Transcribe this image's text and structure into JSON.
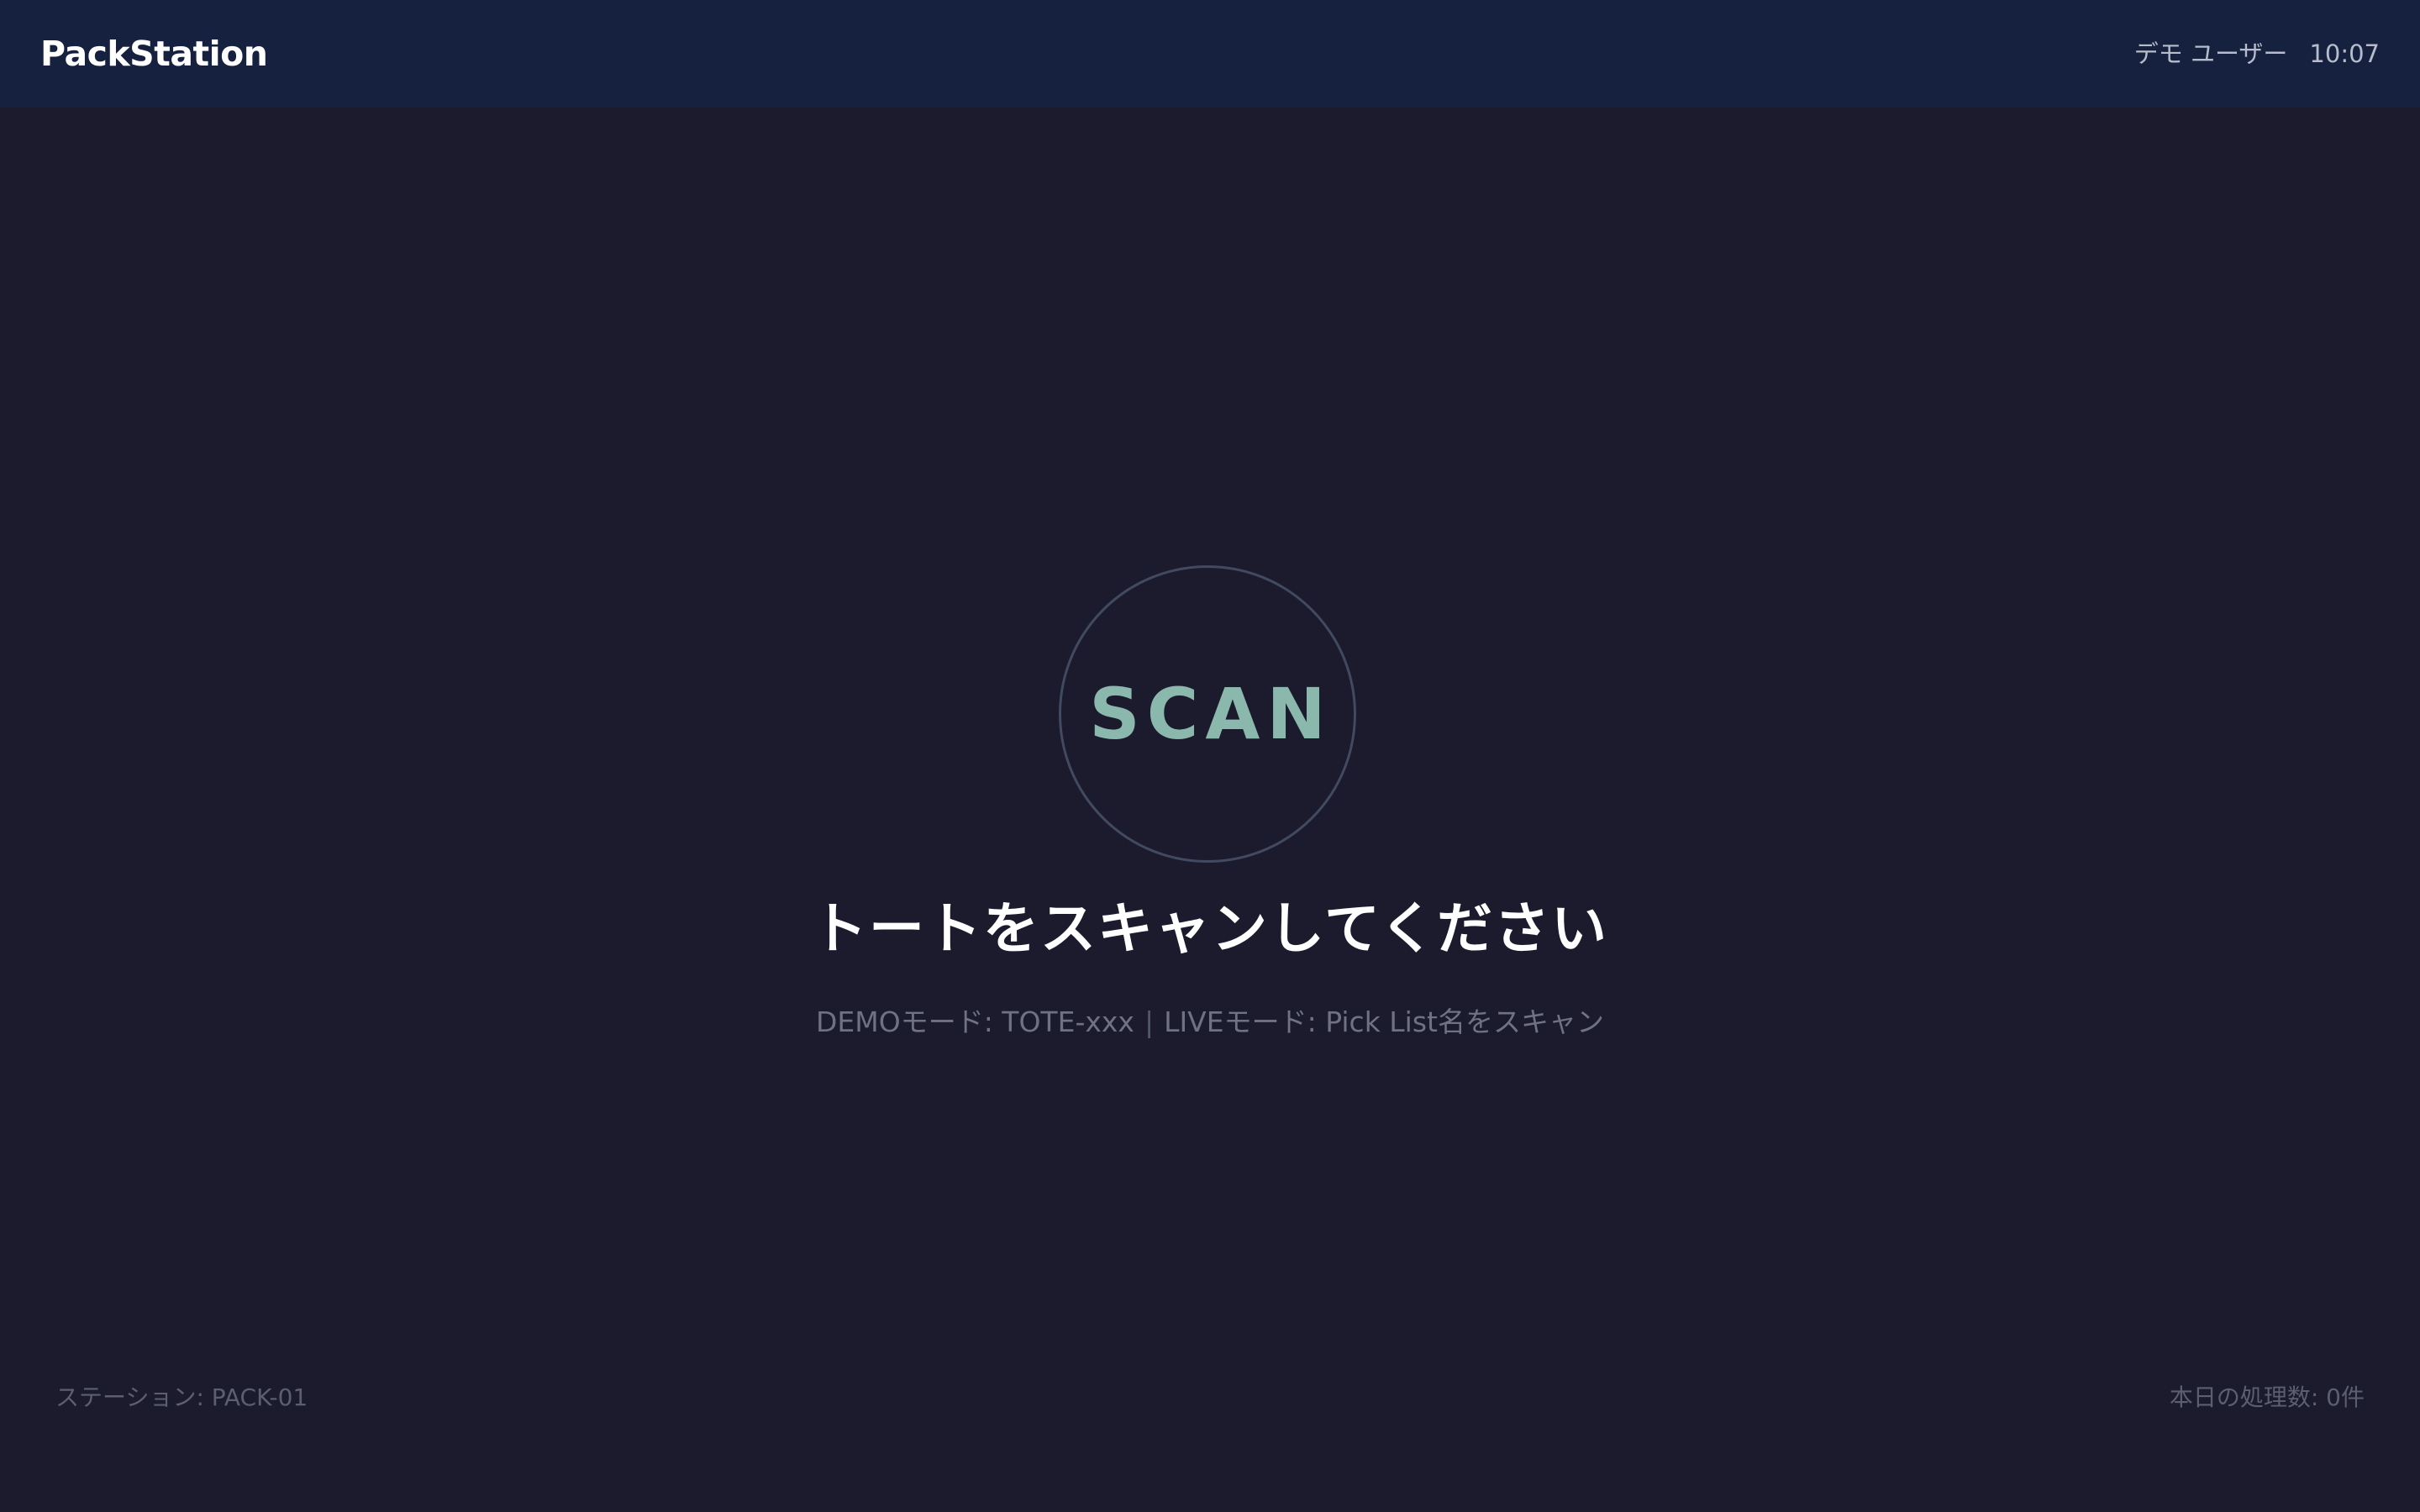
{
  "header": {
    "app_name": "PackStation",
    "user_name": "デモ ユーザー",
    "time": "10:07"
  },
  "scan": {
    "label": "SCAN",
    "instruction": "トートをスキャンしてください",
    "hint_demo": "DEMOモード: TOTE-xxx",
    "hint_separator": "|",
    "hint_live": "LIVEモード: Pick List名をスキャン"
  },
  "footer": {
    "station": "ステーション: PACK-01",
    "processed_today": "本日の処理数: 0件"
  },
  "colors": {
    "background": "#1b1b2d",
    "header_bg": "#162140",
    "scan_accent": "#8ab8ac",
    "circle_border": "#414a60"
  }
}
